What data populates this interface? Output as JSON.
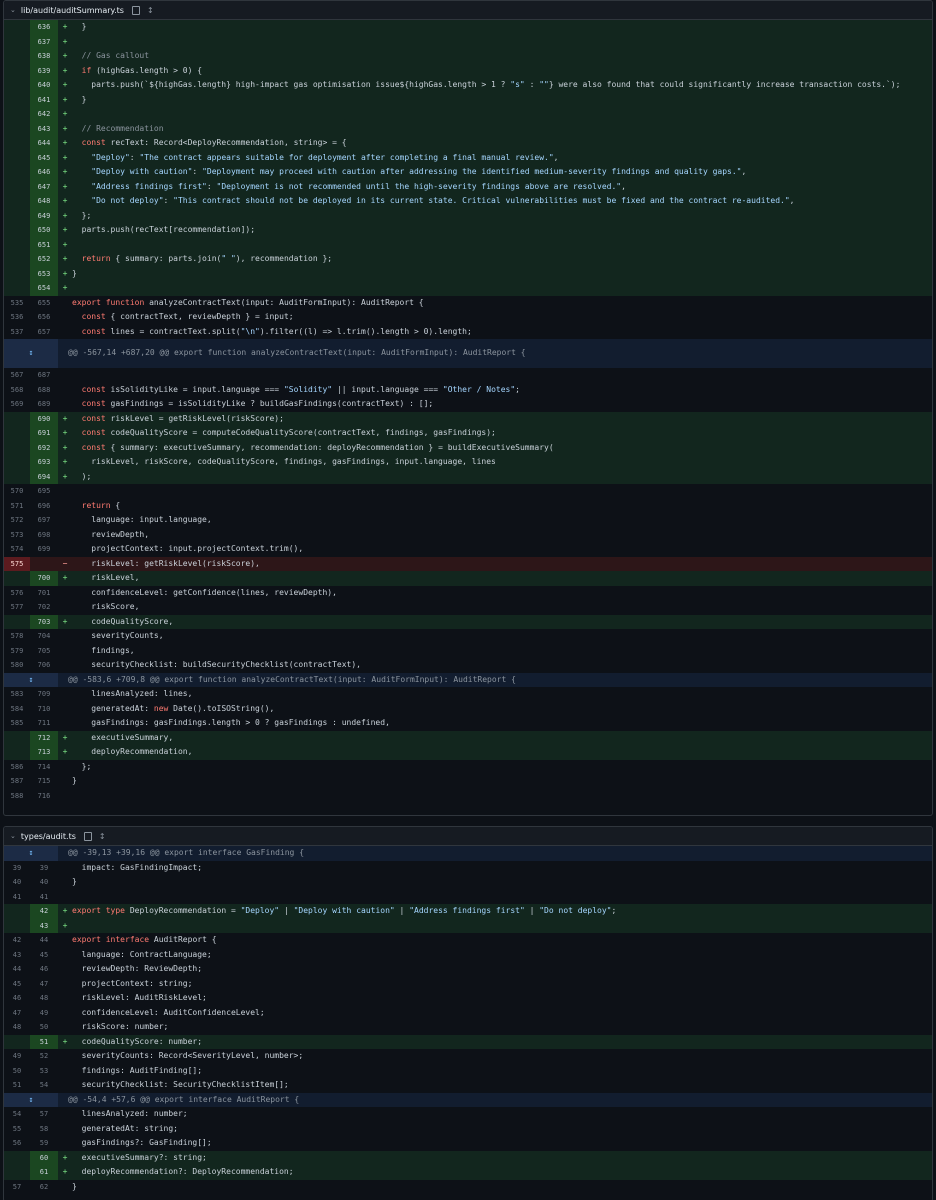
{
  "files": [
    {
      "path": "lib/audit/auditSummary.ts",
      "rows": [
        {
          "kind": "add",
          "old": "",
          "new": "636",
          "code": "  }"
        },
        {
          "kind": "add",
          "old": "",
          "new": "637",
          "code": ""
        },
        {
          "kind": "add",
          "old": "",
          "new": "638",
          "code": "  // Gas callout"
        },
        {
          "kind": "add",
          "old": "",
          "new": "639",
          "code": "  if (highGas.length > 0) {"
        },
        {
          "kind": "add",
          "old": "",
          "new": "640",
          "code": "    parts.push(`${highGas.length} high-impact gas optimisation issue${highGas.length > 1 ? \"s\" : \"\"} were also found that could significantly increase transaction costs.`);"
        },
        {
          "kind": "add",
          "old": "",
          "new": "641",
          "code": "  }"
        },
        {
          "kind": "add",
          "old": "",
          "new": "642",
          "code": ""
        },
        {
          "kind": "add",
          "old": "",
          "new": "643",
          "code": "  // Recommendation"
        },
        {
          "kind": "add",
          "old": "",
          "new": "644",
          "code": "  const recText: Record<DeployRecommendation, string> = {"
        },
        {
          "kind": "add",
          "old": "",
          "new": "645",
          "code": "    \"Deploy\": \"The contract appears suitable for deployment after completing a final manual review.\","
        },
        {
          "kind": "add",
          "old": "",
          "new": "646",
          "code": "    \"Deploy with caution\": \"Deployment may proceed with caution after addressing the identified medium-severity findings and quality gaps.\","
        },
        {
          "kind": "add",
          "old": "",
          "new": "647",
          "code": "    \"Address findings first\": \"Deployment is not recommended until the high-severity findings above are resolved.\","
        },
        {
          "kind": "add",
          "old": "",
          "new": "648",
          "code": "    \"Do not deploy\": \"This contract should not be deployed in its current state. Critical vulnerabilities must be fixed and the contract re-audited.\","
        },
        {
          "kind": "add",
          "old": "",
          "new": "649",
          "code": "  };"
        },
        {
          "kind": "add",
          "old": "",
          "new": "650",
          "code": "  parts.push(recText[recommendation]);"
        },
        {
          "kind": "add",
          "old": "",
          "new": "651",
          "code": ""
        },
        {
          "kind": "add",
          "old": "",
          "new": "652",
          "code": "  return { summary: parts.join(\" \"), recommendation };"
        },
        {
          "kind": "add",
          "old": "",
          "new": "653",
          "code": "}"
        },
        {
          "kind": "add",
          "old": "",
          "new": "654",
          "code": ""
        },
        {
          "kind": "ctx",
          "old": "535",
          "new": "655",
          "code": "export function analyzeContractText(input: AuditFormInput): AuditReport {"
        },
        {
          "kind": "ctx",
          "old": "536",
          "new": "656",
          "code": "  const { contractText, reviewDepth } = input;"
        },
        {
          "kind": "ctx",
          "old": "537",
          "new": "657",
          "code": "  const lines = contractText.split(\"\\n\").filter((l) => l.trim().length > 0).length;"
        },
        {
          "kind": "hunk",
          "code": "@@ -567,14 +687,20 @@ export function analyzeContractText(input: AuditFormInput): AuditReport {",
          "tall": true
        },
        {
          "kind": "ctx",
          "old": "567",
          "new": "687",
          "code": ""
        },
        {
          "kind": "ctx",
          "old": "568",
          "new": "688",
          "code": "  const isSolidityLike = input.language === \"Solidity\" || input.language === \"Other / Notes\";"
        },
        {
          "kind": "ctx",
          "old": "569",
          "new": "689",
          "code": "  const gasFindings = isSolidityLike ? buildGasFindings(contractText) : [];"
        },
        {
          "kind": "add",
          "old": "",
          "new": "690",
          "code": "  const riskLevel = getRiskLevel(riskScore);"
        },
        {
          "kind": "add",
          "old": "",
          "new": "691",
          "code": "  const codeQualityScore = computeCodeQualityScore(contractText, findings, gasFindings);"
        },
        {
          "kind": "add",
          "old": "",
          "new": "692",
          "code": "  const { summary: executiveSummary, recommendation: deployRecommendation } = buildExecutiveSummary("
        },
        {
          "kind": "add",
          "old": "",
          "new": "693",
          "code": "    riskLevel, riskScore, codeQualityScore, findings, gasFindings, input.language, lines"
        },
        {
          "kind": "add",
          "old": "",
          "new": "694",
          "code": "  );"
        },
        {
          "kind": "ctx",
          "old": "570",
          "new": "695",
          "code": ""
        },
        {
          "kind": "ctx",
          "old": "571",
          "new": "696",
          "code": "  return {"
        },
        {
          "kind": "ctx",
          "old": "572",
          "new": "697",
          "code": "    language: input.language,"
        },
        {
          "kind": "ctx",
          "old": "573",
          "new": "698",
          "code": "    reviewDepth,"
        },
        {
          "kind": "ctx",
          "old": "574",
          "new": "699",
          "code": "    projectContext: input.projectContext.trim(),"
        },
        {
          "kind": "del",
          "old": "575",
          "new": "",
          "code": "    riskLevel: getRiskLevel(riskScore),"
        },
        {
          "kind": "add",
          "old": "",
          "new": "700",
          "code": "    riskLevel,"
        },
        {
          "kind": "ctx",
          "old": "576",
          "new": "701",
          "code": "    confidenceLevel: getConfidence(lines, reviewDepth),"
        },
        {
          "kind": "ctx",
          "old": "577",
          "new": "702",
          "code": "    riskScore,"
        },
        {
          "kind": "add",
          "old": "",
          "new": "703",
          "code": "    codeQualityScore,"
        },
        {
          "kind": "ctx",
          "old": "578",
          "new": "704",
          "code": "    severityCounts,"
        },
        {
          "kind": "ctx",
          "old": "579",
          "new": "705",
          "code": "    findings,"
        },
        {
          "kind": "ctx",
          "old": "580",
          "new": "706",
          "code": "    securityChecklist: buildSecurityChecklist(contractText),"
        },
        {
          "kind": "hunk",
          "code": "@@ -583,6 +709,8 @@ export function analyzeContractText(input: AuditFormInput): AuditReport {"
        },
        {
          "kind": "ctx",
          "old": "583",
          "new": "709",
          "code": "    linesAnalyzed: lines,"
        },
        {
          "kind": "ctx",
          "old": "584",
          "new": "710",
          "code": "    generatedAt: new Date().toISOString(),"
        },
        {
          "kind": "ctx",
          "old": "585",
          "new": "711",
          "code": "    gasFindings: gasFindings.length > 0 ? gasFindings : undefined,"
        },
        {
          "kind": "add",
          "old": "",
          "new": "712",
          "code": "    executiveSummary,"
        },
        {
          "kind": "add",
          "old": "",
          "new": "713",
          "code": "    deployRecommendation,"
        },
        {
          "kind": "ctx",
          "old": "586",
          "new": "714",
          "code": "  };"
        },
        {
          "kind": "ctx",
          "old": "587",
          "new": "715",
          "code": "}"
        },
        {
          "kind": "ctx",
          "old": "588",
          "new": "716",
          "code": ""
        }
      ]
    },
    {
      "path": "types/audit.ts",
      "rows": [
        {
          "kind": "hunk",
          "code": "@@ -39,13 +39,16 @@ export interface GasFinding {"
        },
        {
          "kind": "ctx",
          "old": "39",
          "new": "39",
          "code": "  impact: GasFindingImpact;"
        },
        {
          "kind": "ctx",
          "old": "40",
          "new": "40",
          "code": "}"
        },
        {
          "kind": "ctx",
          "old": "41",
          "new": "41",
          "code": ""
        },
        {
          "kind": "add",
          "old": "",
          "new": "42",
          "code": "export type DeployRecommendation = \"Deploy\" | \"Deploy with caution\" | \"Address findings first\" | \"Do not deploy\";"
        },
        {
          "kind": "add",
          "old": "",
          "new": "43",
          "code": ""
        },
        {
          "kind": "ctx",
          "old": "42",
          "new": "44",
          "code": "export interface AuditReport {"
        },
        {
          "kind": "ctx",
          "old": "43",
          "new": "45",
          "code": "  language: ContractLanguage;"
        },
        {
          "kind": "ctx",
          "old": "44",
          "new": "46",
          "code": "  reviewDepth: ReviewDepth;"
        },
        {
          "kind": "ctx",
          "old": "45",
          "new": "47",
          "code": "  projectContext: string;"
        },
        {
          "kind": "ctx",
          "old": "46",
          "new": "48",
          "code": "  riskLevel: AuditRiskLevel;"
        },
        {
          "kind": "ctx",
          "old": "47",
          "new": "49",
          "code": "  confidenceLevel: AuditConfidenceLevel;"
        },
        {
          "kind": "ctx",
          "old": "48",
          "new": "50",
          "code": "  riskScore: number;"
        },
        {
          "kind": "add",
          "old": "",
          "new": "51",
          "code": "  codeQualityScore: number;"
        },
        {
          "kind": "ctx",
          "old": "49",
          "new": "52",
          "code": "  severityCounts: Record<SeverityLevel, number>;"
        },
        {
          "kind": "ctx",
          "old": "50",
          "new": "53",
          "code": "  findings: AuditFinding[];"
        },
        {
          "kind": "ctx",
          "old": "51",
          "new": "54",
          "code": "  securityChecklist: SecurityChecklistItem[];"
        },
        {
          "kind": "hunk",
          "code": "@@ -54,4 +57,6 @@ export interface AuditReport {"
        },
        {
          "kind": "ctx",
          "old": "54",
          "new": "57",
          "code": "  linesAnalyzed: number;"
        },
        {
          "kind": "ctx",
          "old": "55",
          "new": "58",
          "code": "  generatedAt: string;"
        },
        {
          "kind": "ctx",
          "old": "56",
          "new": "59",
          "code": "  gasFindings?: GasFinding[];"
        },
        {
          "kind": "add",
          "old": "",
          "new": "60",
          "code": "  executiveSummary?: string;"
        },
        {
          "kind": "add",
          "old": "",
          "new": "61",
          "code": "  deployRecommendation?: DeployRecommendation;"
        },
        {
          "kind": "ctx",
          "old": "57",
          "new": "62",
          "code": "}"
        }
      ]
    }
  ],
  "icons": {
    "chevron": "chevron-down-icon",
    "copy": "copy-icon",
    "expand": "expand-icon",
    "expand_hunk": "unfold-icon"
  },
  "colors": {
    "added_bg": "#12261e",
    "removed_bg": "#2d1618",
    "hunk_bg": "#121d2f",
    "background": "#0d1117"
  }
}
